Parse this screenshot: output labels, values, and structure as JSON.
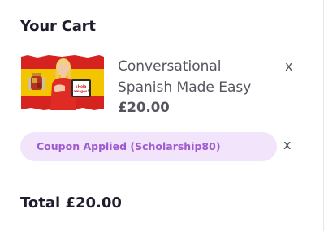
{
  "cart": {
    "title": "Your Cart",
    "items": [
      {
        "name": "Conversational Spanish Made Easy",
        "price": "£20.00",
        "remove_label": "x",
        "thumbnail_icon": "spain-flag-course-thumbnail",
        "thumbnail_sign_text": "¡Hola amigos!"
      }
    ],
    "coupon": {
      "label": "Coupon Applied (Scholarship80)",
      "remove_label": "x"
    },
    "total": "Total £20.00"
  },
  "colors": {
    "coupon_bg": "#f2e4fb",
    "coupon_text": "#a05ad0",
    "heading": "#1d1d2c",
    "body_text": "#55555e"
  }
}
